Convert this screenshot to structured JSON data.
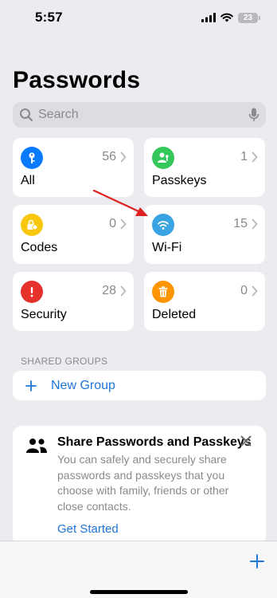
{
  "status_bar": {
    "time": "5:57",
    "battery": "23"
  },
  "header": {
    "title": "Passwords"
  },
  "search": {
    "placeholder": "Search"
  },
  "tiles": [
    {
      "label": "All",
      "count": "56",
      "icon": "key-icon",
      "color": "#0a7aff"
    },
    {
      "label": "Passkeys",
      "count": "1",
      "icon": "person-key-icon",
      "color": "#34c759"
    },
    {
      "label": "Codes",
      "count": "0",
      "icon": "lock-clock-icon",
      "color": "#f9c80e"
    },
    {
      "label": "Wi-Fi",
      "count": "15",
      "icon": "wifi-icon",
      "color": "#3aa3e3"
    },
    {
      "label": "Security",
      "count": "28",
      "icon": "exclamation-icon",
      "color": "#e5322d"
    },
    {
      "label": "Deleted",
      "count": "0",
      "icon": "trash-icon",
      "color": "#ff9500"
    }
  ],
  "shared_groups": {
    "header": "SHARED GROUPS",
    "new_group_label": "New Group"
  },
  "share_card": {
    "title": "Share Passwords and Passkeys",
    "body": "You can safely and securely share passwords and passkeys that you choose with family, friends or other close contacts.",
    "link": "Get Started"
  },
  "colors": {
    "accent": "#1e74d8",
    "annotation_arrow": "#e02020"
  }
}
